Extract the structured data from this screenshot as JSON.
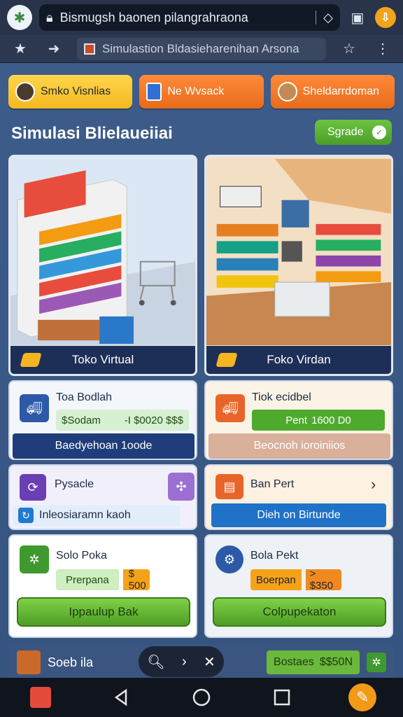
{
  "browser": {
    "url_text": "Bismugsh baonen pilangrahraona",
    "tab_title": "Simulastion Bldasieharenihan Arsona"
  },
  "top_tabs": [
    {
      "label": "Smko Visnlias"
    },
    {
      "label": "Ne Wvsack"
    },
    {
      "label": "Sheldarrdoman"
    }
  ],
  "section": {
    "title": "Simulasi Blielaueiiai",
    "upgrade_label": "Sgrade"
  },
  "stores": [
    {
      "label": "Toko Virtual"
    },
    {
      "label": "Foko Virdan"
    }
  ],
  "cards": {
    "c1": {
      "title": "Toa Bodlah",
      "price_label": "$Sodam",
      "price_value": "-I $0020 $$$",
      "button": "Baedyehoan 1oode"
    },
    "c2": {
      "title": "Tiok ecidbel",
      "price_label": "Pent",
      "price_value": "1600 D0",
      "button": "Beocnoh ioroiniios"
    },
    "c3": {
      "title": "Pysacle",
      "sub": "Inleosiaramn kaoh"
    },
    "c4": {
      "title": "Ban Pert",
      "button": "Dieh on Birtunde"
    },
    "c5": {
      "title": "Solo Poka",
      "price_label": "Prerpana",
      "price_value": "$ 500",
      "button": "Ippaulup Bak"
    },
    "c6": {
      "title": "Bola Pekt",
      "price_label": "Boerpan",
      "price_value": "> $350",
      "button": "Colpupekaton"
    }
  },
  "bottom_strip": {
    "left_label": "Soeb ila",
    "right_label": "Bostaes",
    "right_value": "$$50N"
  },
  "colors": {
    "accent_green": "#5bb334",
    "accent_orange": "#f07a28",
    "navy": "#1e2f57",
    "yellow": "#f4b81f"
  }
}
